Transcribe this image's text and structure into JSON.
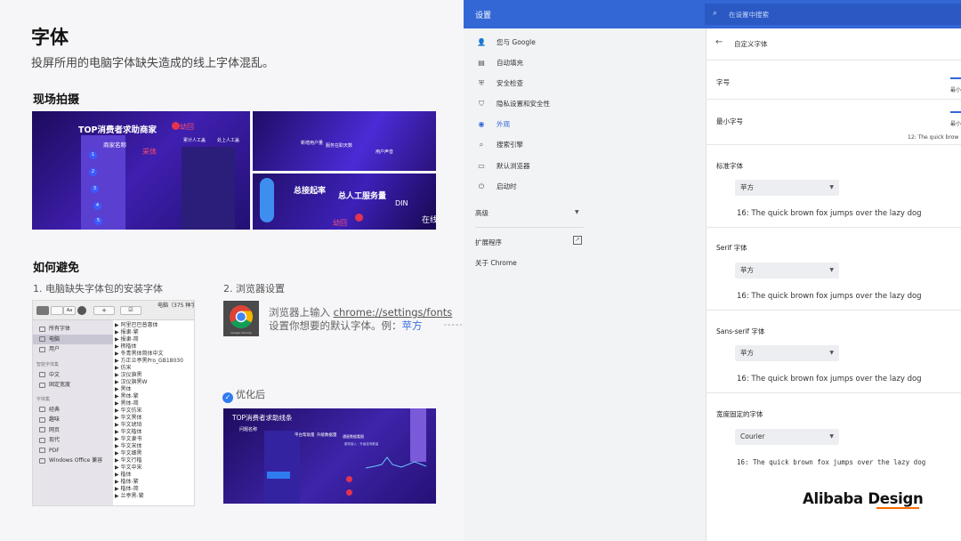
{
  "slide": {
    "title": "字体",
    "subtitle": "投屏所用的电脑字体缺失造成的线上字体混乱。",
    "section_scene": "现场拍摄",
    "section_avoid": "如何避免",
    "step1": "1. 电脑缺失字体包的安装字体",
    "step2": "2. 浏览器设置",
    "step2_line1_prefix": "浏览器上输入 ",
    "step2_link": "chrome://settings/fonts",
    "step2_line2_prefix": "设置你想要的默认字体。例：",
    "step2_example": "苹方",
    "optimized": "优化后",
    "chrome_icon_label": "Google Chrome"
  },
  "photos": {
    "ph1": {
      "header": "TOP消费者求助商家",
      "red": "幼回",
      "col1": "商家名称",
      "col2": "累计人工盖",
      "col3": "处上人工盖",
      "red2": "采体",
      "nums": [
        "1",
        "2",
        "3",
        "4",
        "5"
      ]
    },
    "ph2": {
      "t1": "新增用户量",
      "t2": "服务在职天数",
      "t3": "用户声音"
    },
    "ph3": {
      "t1": "总接起率",
      "t2": "总人工服务量",
      "t3": "DIN",
      "t4": "在线",
      "red": "幼回"
    },
    "ph4": {
      "header": "TOP消费者求助线条",
      "t1": "问题名称",
      "t2": "平台帮助量",
      "t3": "升级数据量",
      "t4": "通星数据看图",
      "t5": "服务接入 · 升级查询数量"
    }
  },
  "fontbook": {
    "title": "电脑（375 种字",
    "sidebar": [
      {
        "label": "所有字体",
        "selected": false
      },
      {
        "label": "电脑",
        "selected": true
      },
      {
        "label": "用户",
        "selected": false
      }
    ],
    "smart_head": "智能字体集",
    "smart": [
      {
        "label": "中文"
      },
      {
        "label": "固定宽度"
      }
    ],
    "coll_head": "字体集",
    "collections": [
      {
        "label": "经典"
      },
      {
        "label": "趣味"
      },
      {
        "label": "网页"
      },
      {
        "label": "现代"
      },
      {
        "label": "PDF"
      },
      {
        "label": "Windows Office 兼容"
      }
    ],
    "fonts": [
      "阿里巴巴普惠体",
      "报隶-繁",
      "报隶-简",
      "楞楷体",
      "冬青黑体简体中文",
      "方正兰亭黑Pro_GB18030",
      "仿宋",
      "汉仪旗黑",
      "汉仪旗黑W",
      "黑体",
      "黑体-繁",
      "黑体-简",
      "华文仿宋",
      "华文黑体",
      "华文琥珀",
      "华文楷体",
      "华文隶书",
      "华文宋体",
      "华文细黑",
      "华文行楷",
      "华文中宋",
      "楷体",
      "楷体-繁",
      "楷体-简",
      "兰亭黑-繁"
    ]
  },
  "settings": {
    "header_title": "设置",
    "search_placeholder": "在设置中搜索",
    "nav": [
      {
        "label": "您与 Google",
        "icon": "person-icon",
        "glyph": "👤",
        "active": false
      },
      {
        "label": "自动填充",
        "icon": "clipboard-icon",
        "glyph": "▤",
        "active": false
      },
      {
        "label": "安全检查",
        "icon": "shield-check-icon",
        "glyph": "⛨",
        "active": false
      },
      {
        "label": "隐私设置和安全性",
        "icon": "shield-icon",
        "glyph": "⛉",
        "active": false
      },
      {
        "label": "外观",
        "icon": "palette-icon",
        "glyph": "◉",
        "active": true
      },
      {
        "label": "搜索引擎",
        "icon": "search-icon",
        "glyph": "⌕",
        "active": false
      },
      {
        "label": "默认浏览器",
        "icon": "browser-icon",
        "glyph": "▭",
        "active": false
      },
      {
        "label": "启动时",
        "icon": "power-icon",
        "glyph": "⏻",
        "active": false
      }
    ],
    "advanced": "高级",
    "extensions": "扩展程序",
    "about": "关于 Chrome",
    "panel_title": "自定义字体",
    "font_size_label": "字号",
    "min_size_label": "最小字号",
    "min_tag": "最小",
    "min_sample": "12: The quick brow",
    "standard_label": "标准字体",
    "standard_value": "苹方",
    "standard_sample": "16: The quick brown fox jumps over the lazy dog",
    "serif_label": "Serif 字体",
    "serif_value": "苹方",
    "serif_sample": "16: The quick brown fox jumps over the lazy dog",
    "sans_label": "Sans-serif 字体",
    "sans_value": "苹方",
    "sans_sample": "16: The quick brown fox jumps over the lazy dog",
    "fixed_label": "宽度固定的字体",
    "fixed_value": "Courier",
    "fixed_sample": "16: The quick brown fox jumps over the lazy dog"
  },
  "brand": "Alibaba Design",
  "colors": {
    "chrome_blue": "#3367d6",
    "accent_blue": "#3b6fe0",
    "brand_orange": "#ff6a00"
  }
}
